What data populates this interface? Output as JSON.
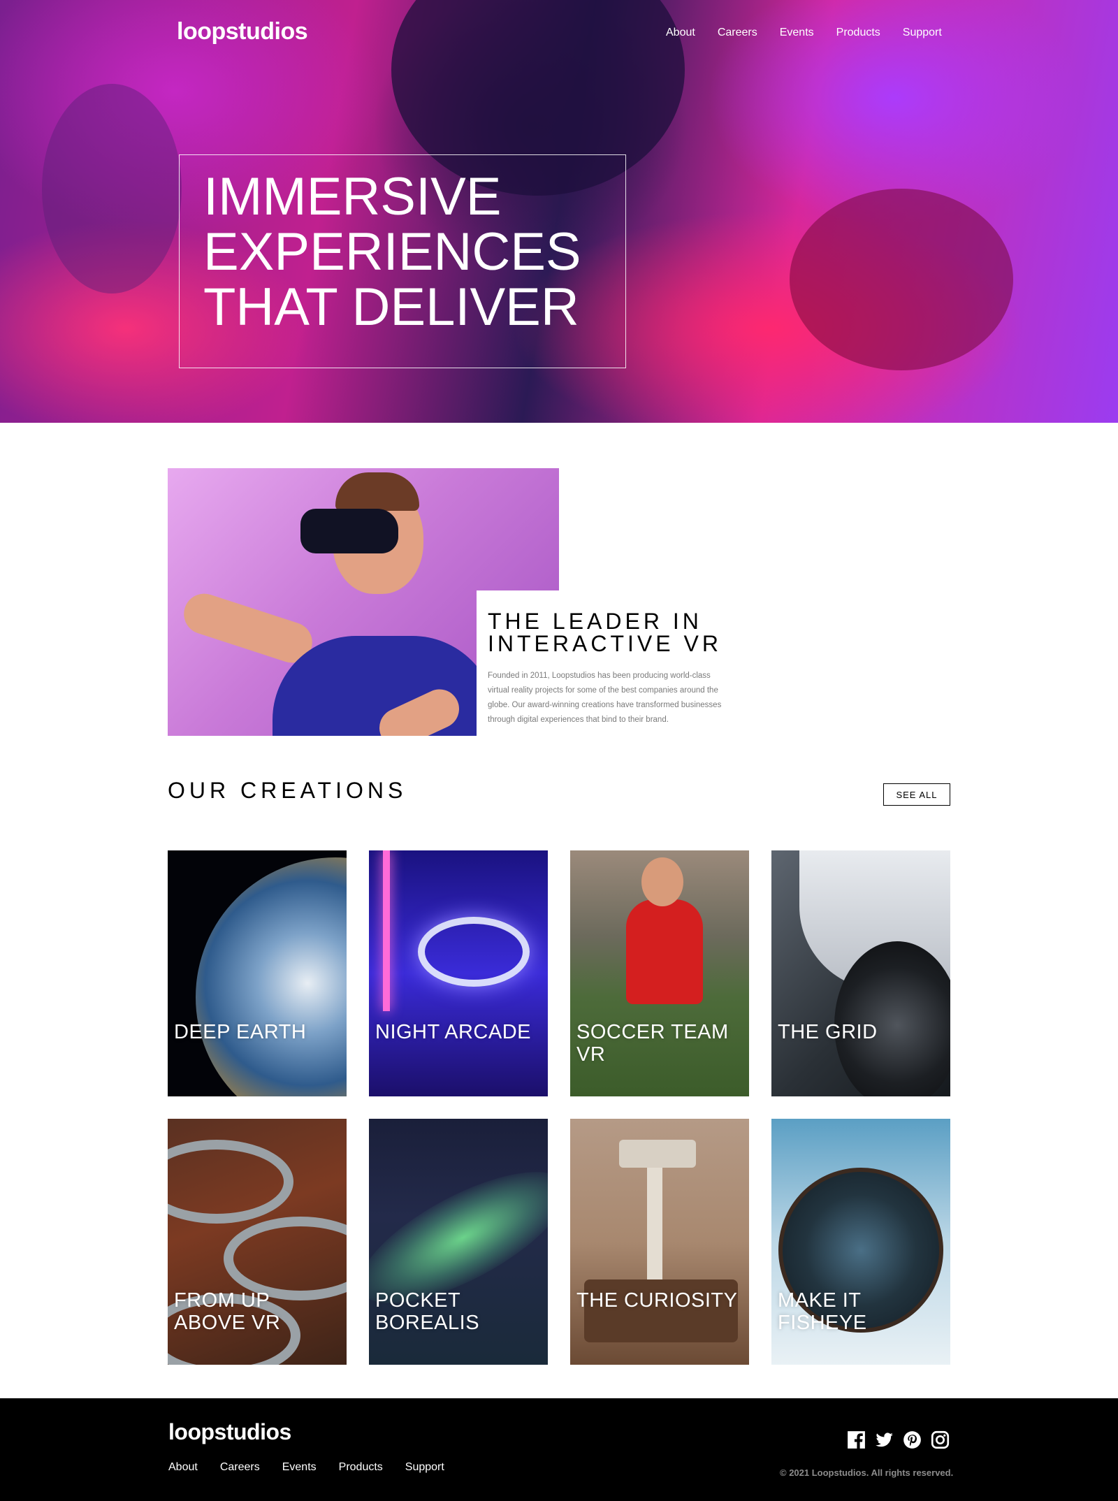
{
  "header": {
    "logo": "loopstudios",
    "nav": [
      "About",
      "Careers",
      "Events",
      "Products",
      "Support"
    ]
  },
  "hero": {
    "title_lines": [
      "IMMERSIVE",
      "EXPERIENCES",
      "THAT DELIVER"
    ]
  },
  "interactive": {
    "title_lines": [
      "THE LEADER IN",
      "INTERACTIVE VR"
    ],
    "body": "Founded in 2011, Loopstudios has been producing world-class virtual reality projects for some of the best companies around the globe. Our award-winning creations have transformed businesses through digital experiences that bind to their brand."
  },
  "creations": {
    "title": "OUR CREATIONS",
    "see_all": "SEE ALL",
    "items": [
      {
        "label": "DEEP EARTH"
      },
      {
        "label": "NIGHT ARCADE"
      },
      {
        "label": "SOCCER TEAM VR"
      },
      {
        "label": "THE GRID"
      },
      {
        "label": "FROM UP ABOVE VR"
      },
      {
        "label": "POCKET BOREALIS"
      },
      {
        "label": "THE CURIOSITY"
      },
      {
        "label": "MAKE IT FISHEYE"
      }
    ]
  },
  "footer": {
    "logo": "loopstudios",
    "nav": [
      "About",
      "Careers",
      "Events",
      "Products",
      "Support"
    ],
    "socials": [
      "facebook-icon",
      "twitter-icon",
      "pinterest-icon",
      "instagram-icon"
    ],
    "copyright": "© 2021 Loopstudios. All rights reserved."
  },
  "colors": {
    "footer_bg": "#000000",
    "text_muted": "#7a7a7a",
    "hero_magenta": "#d7279c",
    "hero_violet": "#9b3cf0"
  }
}
